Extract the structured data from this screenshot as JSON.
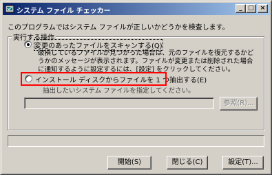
{
  "window": {
    "title": "システム ファイル チェッカー",
    "minimize_glyph": "_",
    "maximize_glyph": "□",
    "close_glyph": "×"
  },
  "description": "このプログラムではシステム ファイルが正しいかどうかを検査します。",
  "group": {
    "legend": "実行する操作",
    "option_scan": {
      "label": "変更のあったファイルをスキャンする(Q)",
      "selected": true
    },
    "option_scan_note": "破損しているファイルが見つかった場合は、元のファイルを復元するかどうかのメッセージが表示されます。ファイルが変更または削除された場合に通知するように設定するには、[設定] をクリックしてください。",
    "option_extract": {
      "label": "インストール ディスクからファイルを 1 つ抽出する(E)",
      "selected": false
    },
    "extract_hint": "抽出したいシステム ファイルを指定してください。",
    "file_value": "",
    "browse_label": "参照(R)..."
  },
  "progress": {
    "value": 0
  },
  "buttons": {
    "start": "開始(S)",
    "close": "閉じる(C)",
    "settings": "設定(T)..."
  },
  "colors": {
    "annotation_highlight": "#ff0000",
    "titlebar_start": "#0a246a",
    "titlebar_end": "#a6caf0"
  }
}
